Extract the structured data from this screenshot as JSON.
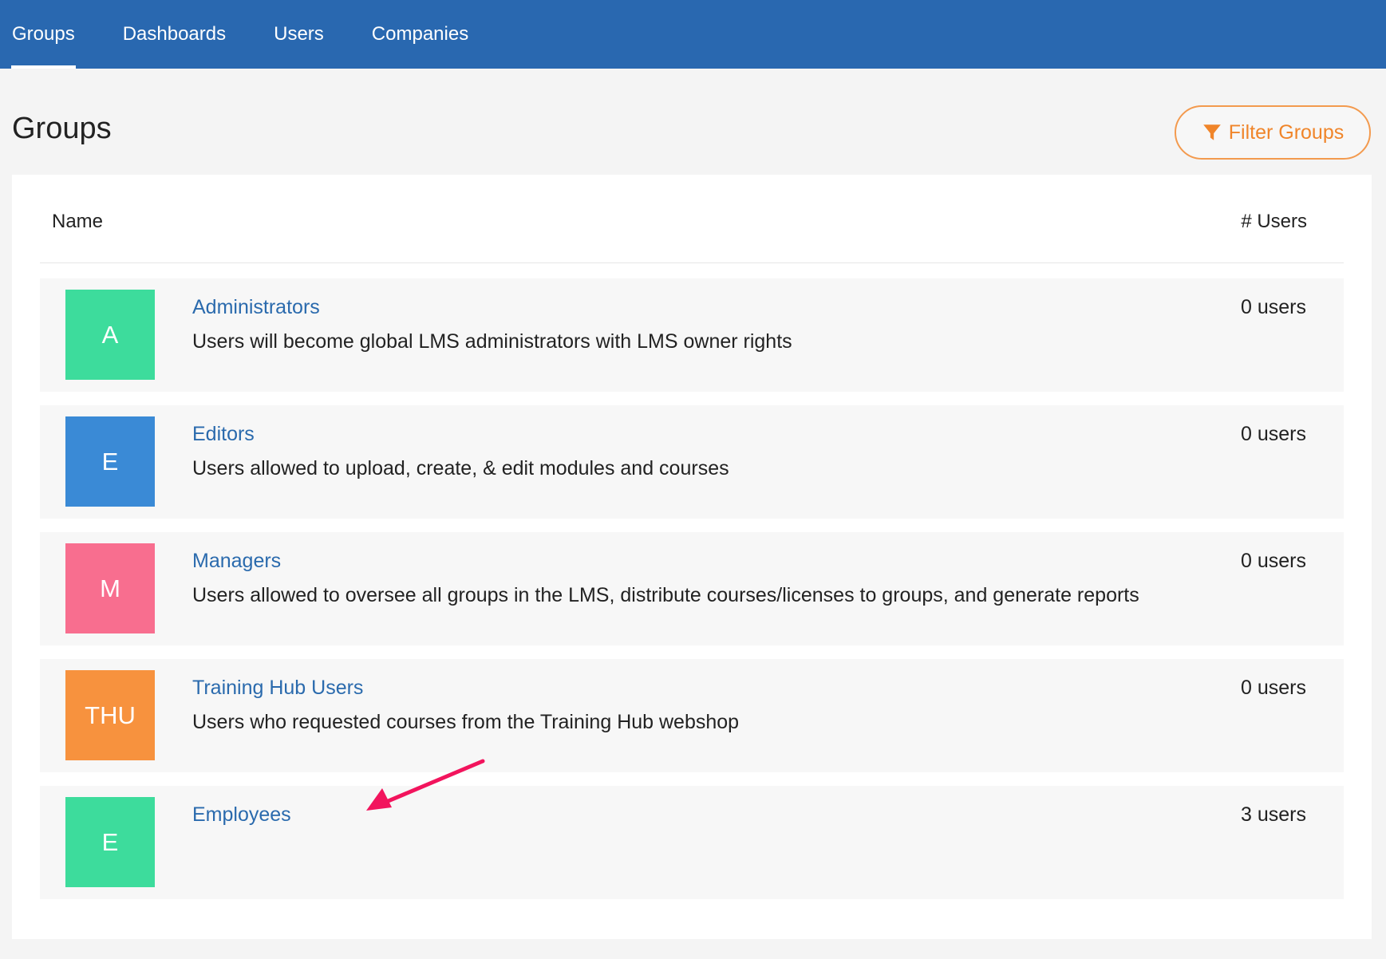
{
  "nav": {
    "items": [
      {
        "label": "Groups",
        "active": true
      },
      {
        "label": "Dashboards",
        "active": false
      },
      {
        "label": "Users",
        "active": false
      },
      {
        "label": "Companies",
        "active": false
      }
    ]
  },
  "page": {
    "title": "Groups",
    "filter_label": "Filter Groups",
    "filter_icon": "filter-icon"
  },
  "table": {
    "headers": {
      "name": "Name",
      "users": "# Users"
    },
    "rows": [
      {
        "initials": "A",
        "color": "#3ddc9c",
        "name": "Administrators",
        "description": "Users will become global LMS administrators with LMS owner rights",
        "count": "0 users"
      },
      {
        "initials": "E",
        "color": "#3a8ad6",
        "name": "Editors",
        "description": "Users allowed to upload, create, & edit modules and courses",
        "count": "0 users"
      },
      {
        "initials": "M",
        "color": "#f86e8f",
        "name": "Managers",
        "description": "Users allowed to oversee all groups in the LMS, distribute courses/licenses to groups, and generate reports",
        "count": "0 users"
      },
      {
        "initials": "THU",
        "color": "#f7923e",
        "name": "Training Hub Users",
        "description": "Users who requested courses from the Training Hub webshop",
        "count": "0 users"
      },
      {
        "initials": "E",
        "color": "#3ddc9c",
        "name": "Employees",
        "description": "",
        "count": "3 users"
      }
    ]
  },
  "colors": {
    "nav_bg": "#2968b0",
    "accent_orange": "#f0852a",
    "link_blue": "#2a6aad",
    "annotation_arrow": "#f2145d"
  }
}
